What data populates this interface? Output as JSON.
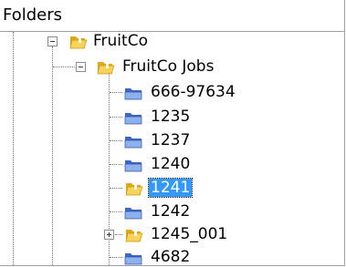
{
  "panel": {
    "title": "Folders"
  },
  "tree": {
    "root": {
      "label": "FruitCo",
      "expanded": true,
      "icon": "folder-open-yellow-icon"
    },
    "jobs": {
      "label": "FruitCo Jobs",
      "expanded": true,
      "icon": "folder-open-yellow-icon"
    },
    "items": [
      {
        "label": "666-97634",
        "icon": "folder-blue-icon",
        "selected": false,
        "expandable": false
      },
      {
        "label": "1235",
        "icon": "folder-blue-icon",
        "selected": false,
        "expandable": false
      },
      {
        "label": "1237",
        "icon": "folder-blue-icon",
        "selected": false,
        "expandable": false
      },
      {
        "label": "1240",
        "icon": "folder-blue-icon",
        "selected": false,
        "expandable": false
      },
      {
        "label": "1241",
        "icon": "folder-open-yellow-icon",
        "selected": true,
        "expandable": false
      },
      {
        "label": "1242",
        "icon": "folder-blue-icon",
        "selected": false,
        "expandable": false
      },
      {
        "label": "1245_001",
        "icon": "folder-open-yellow-icon",
        "selected": false,
        "expandable": true
      },
      {
        "label": "4682",
        "icon": "folder-blue-icon",
        "selected": false,
        "expandable": false
      }
    ]
  },
  "colors": {
    "selection_background": "#3399ff",
    "selection_text": "#ffffff",
    "blue_folder": "#5a82d6",
    "yellow_folder": "#f2c230"
  }
}
